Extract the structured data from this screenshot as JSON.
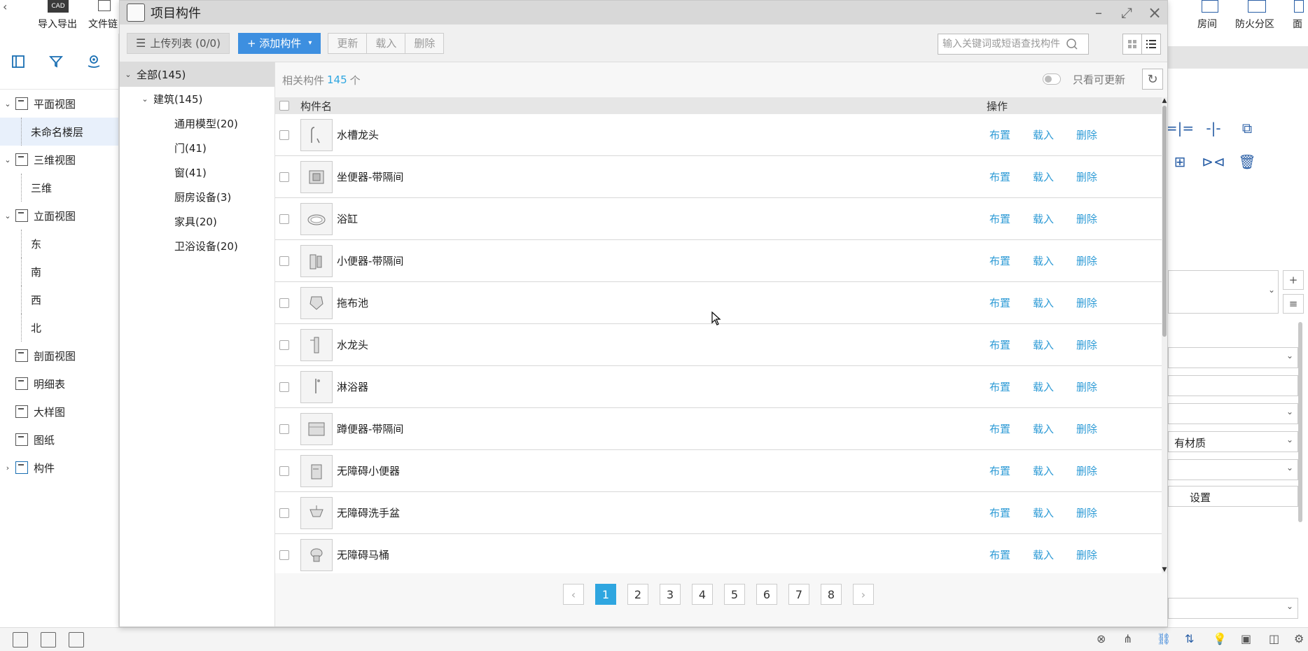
{
  "app": {
    "top_toolbar": [
      {
        "label": "导入导出",
        "icon": "cad-icon"
      },
      {
        "label": "文件链",
        "icon": "file-link-icon"
      }
    ],
    "right_toolbar": [
      {
        "label": "房间",
        "icon": "room-icon"
      },
      {
        "label": "防火分区",
        "icon": "fire-zone-icon"
      },
      {
        "label": "面",
        "icon": "area-icon"
      }
    ],
    "left_tools": [
      "panel-icon",
      "filter-icon",
      "location-icon"
    ],
    "tree": [
      {
        "label": "平面视图",
        "level": 0,
        "expanded": true
      },
      {
        "label": "未命名楼层",
        "level": 1,
        "selected": true
      },
      {
        "label": "三维视图",
        "level": 0,
        "expanded": true
      },
      {
        "label": "三维",
        "level": 1
      },
      {
        "label": "立面视图",
        "level": 0,
        "expanded": true
      },
      {
        "label": "东",
        "level": 1
      },
      {
        "label": "南",
        "level": 1
      },
      {
        "label": "西",
        "level": 1
      },
      {
        "label": "北",
        "level": 1
      },
      {
        "label": "剖面视图",
        "level": 0
      },
      {
        "label": "明细表",
        "level": 0
      },
      {
        "label": "大样图",
        "level": 0
      },
      {
        "label": "图纸",
        "level": 0
      },
      {
        "label": "构件",
        "level": 0,
        "collapsed": true
      }
    ],
    "right_panel": {
      "material_value": "有材质",
      "settings_button": "设置"
    }
  },
  "dialog": {
    "title": "项目构件",
    "toolbar": {
      "upload_label": "上传列表 (0/0)",
      "add_label": "+ 添加构件",
      "update_label": "更新",
      "load_label": "载入",
      "delete_label": "删除"
    },
    "search": {
      "placeholder": "输入关键词或短语查找构件"
    },
    "categories": {
      "all": "全部(145)",
      "group": "建筑(145)",
      "children": [
        "通用模型(20)",
        "门(41)",
        "窗(41)",
        "厨房设备(3)",
        "家具(20)",
        "卫浴设备(20)"
      ]
    },
    "list": {
      "related_prefix": "相关构件",
      "related_count": "145",
      "related_suffix": "个",
      "toggle_label": "只看可更新",
      "col_name": "构件名",
      "col_op": "操作",
      "actions": {
        "place": "布置",
        "load": "载入",
        "delete": "删除"
      },
      "rows": [
        "水槽龙头",
        "坐便器-带隔间",
        "浴缸",
        "小便器-带隔间",
        "拖布池",
        "水龙头",
        "淋浴器",
        "蹲便器-带隔间",
        "无障碍小便器",
        "无障碍洗手盆",
        "无障碍马桶"
      ]
    },
    "pager": {
      "pages": [
        "1",
        "2",
        "3",
        "4",
        "5",
        "6",
        "7",
        "8"
      ],
      "active": "1",
      "prev": "‹",
      "next": "›"
    }
  }
}
